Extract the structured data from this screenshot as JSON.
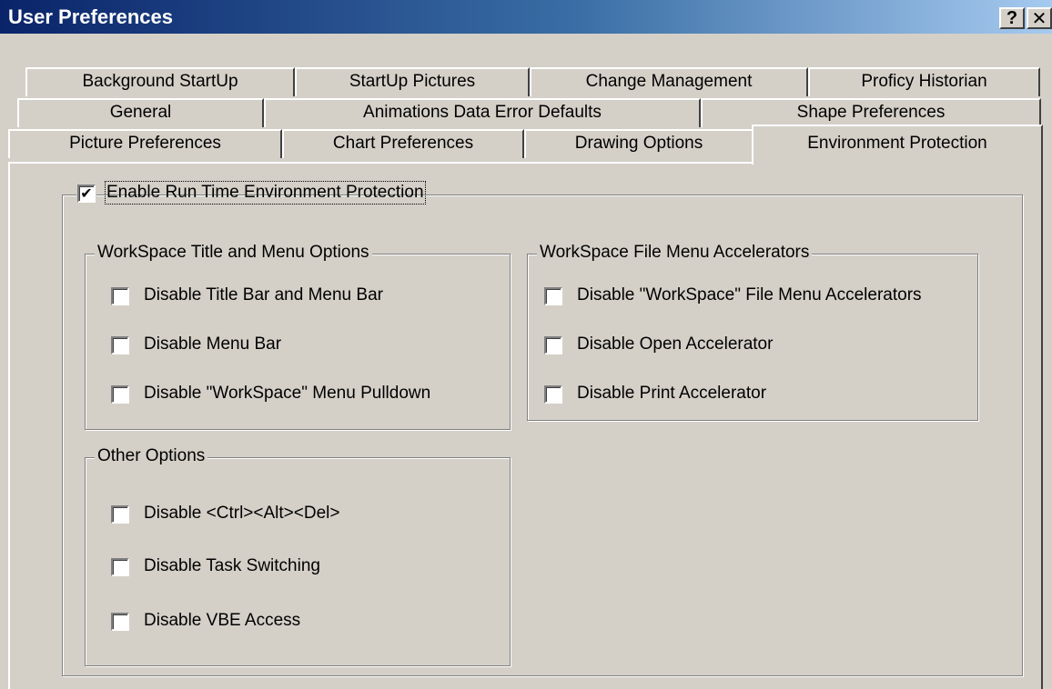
{
  "window": {
    "title": "User Preferences",
    "help_glyph": "?",
    "close_glyph": "✕"
  },
  "tabs": {
    "row1": [
      "Background StartUp",
      "StartUp Pictures",
      "Change Management",
      "Proficy Historian"
    ],
    "row2": [
      "General",
      "Animations Data Error Defaults",
      "Shape Preferences"
    ],
    "row3": [
      "Picture Preferences",
      "Chart Preferences",
      "Drawing Options",
      "Environment Protection"
    ],
    "active": "Environment Protection"
  },
  "main": {
    "enable_protection": {
      "label": "Enable Run Time Environment Protection",
      "checked": true,
      "check_glyph": "✔"
    },
    "title_menu_group": {
      "title": "WorkSpace Title and Menu Options",
      "items": [
        {
          "label": "Disable Title Bar and Menu Bar",
          "checked": false
        },
        {
          "label": "Disable Menu Bar",
          "checked": false
        },
        {
          "label": "Disable \"WorkSpace\" Menu Pulldown",
          "checked": false
        }
      ]
    },
    "file_menu_group": {
      "title": "WorkSpace File Menu Accelerators",
      "items": [
        {
          "label": "Disable \"WorkSpace\" File Menu Accelerators",
          "checked": false
        },
        {
          "label": "Disable Open Accelerator",
          "checked": false
        },
        {
          "label": "Disable Print Accelerator",
          "checked": false
        }
      ]
    },
    "other_group": {
      "title": "Other Options",
      "items": [
        {
          "label": "Disable <Ctrl><Alt><Del>",
          "checked": false
        },
        {
          "label": "Disable Task Switching",
          "checked": false
        },
        {
          "label": "Disable VBE Access",
          "checked": false
        }
      ]
    }
  }
}
